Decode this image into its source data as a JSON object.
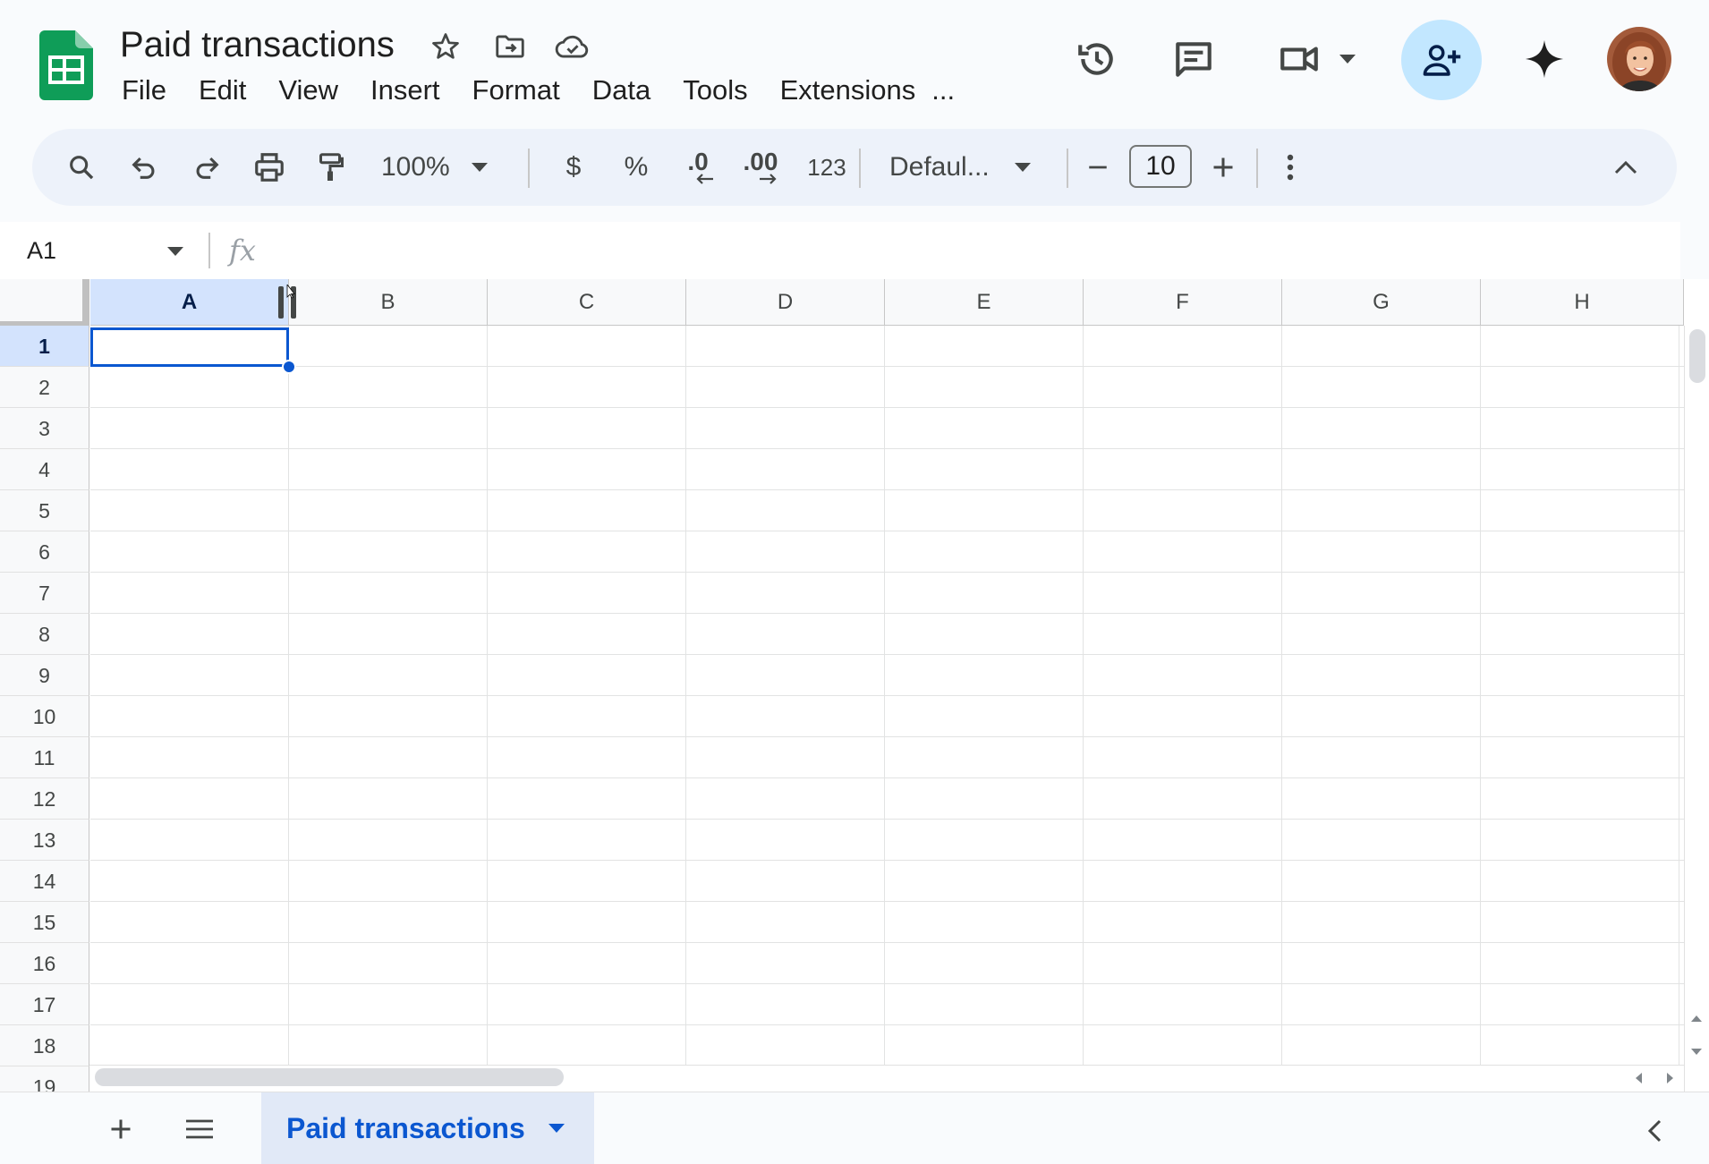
{
  "header": {
    "title": "Paid transactions",
    "menu": [
      "File",
      "Edit",
      "View",
      "Insert",
      "Format",
      "Data",
      "Tools",
      "Extensions",
      "..."
    ]
  },
  "toolbar": {
    "zoom": "100%",
    "currency_label": "$",
    "percent_label": "%",
    "decrease_decimal_label": ".0",
    "increase_decimal_label": ".00",
    "number_format_label": "123",
    "font_name": "Defaul...",
    "font_size": "10"
  },
  "formula_bar": {
    "name_box": "A1",
    "fx_label": "fx",
    "formula_value": ""
  },
  "grid": {
    "columns": [
      "A",
      "B",
      "C",
      "D",
      "E",
      "F",
      "G",
      "H"
    ],
    "rows": [
      "1",
      "2",
      "3",
      "4",
      "5",
      "6",
      "7",
      "8",
      "9",
      "10",
      "11",
      "12",
      "13",
      "14",
      "15",
      "16",
      "17",
      "18",
      "19"
    ],
    "active_cell": "A1"
  },
  "sheets": {
    "tabs": [
      {
        "label": "Paid transactions",
        "active": true
      }
    ]
  },
  "colors": {
    "accent": "#0b57d0",
    "selection": "#d3e3fd",
    "share_button": "#c2e7ff",
    "sheets_green": "#0f9d58"
  }
}
